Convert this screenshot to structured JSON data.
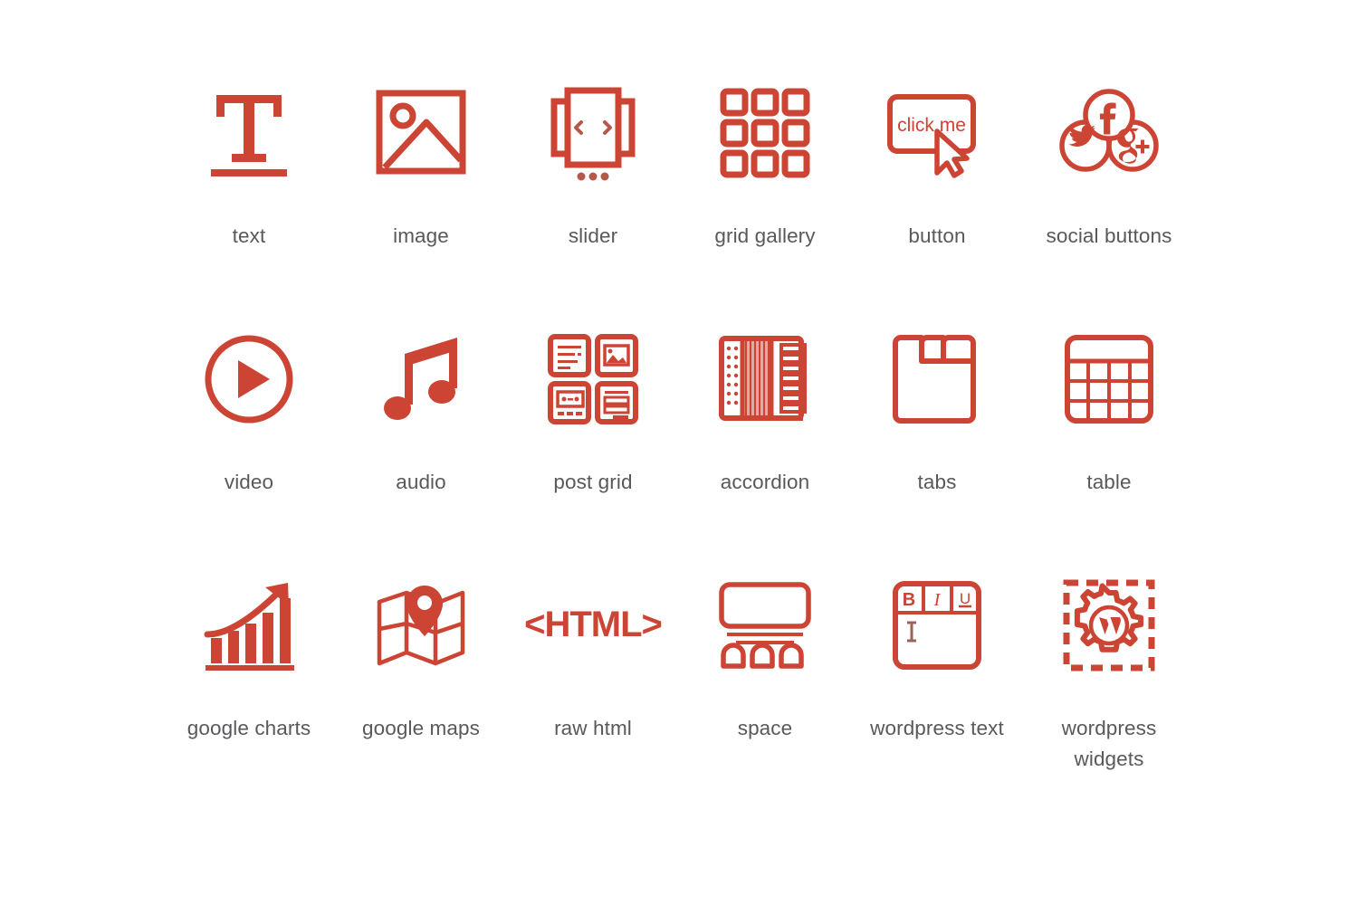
{
  "page": {
    "background_color": "#ffffff",
    "accent_color": "#cc4433",
    "label_color": "#58595b",
    "columns": 6,
    "rows": 3
  },
  "icons": [
    {
      "id": "text",
      "label": "text",
      "icon_name": "serif-t-underline-icon"
    },
    {
      "id": "image",
      "label": "image",
      "icon_name": "picture-frame-icon"
    },
    {
      "id": "slider",
      "label": "slider",
      "icon_name": "carousel-slider-icon"
    },
    {
      "id": "grid_gallery",
      "label": "grid gallery",
      "icon_name": "grid-gallery-icon"
    },
    {
      "id": "button",
      "label": "button",
      "icon_name": "click-me-button-cursor-icon",
      "glyph_text": "click me"
    },
    {
      "id": "social_buttons",
      "label": "social buttons",
      "icon_name": "social-circles-icon",
      "glyph_text": "f"
    },
    {
      "id": "video",
      "label": "video",
      "icon_name": "play-circle-icon"
    },
    {
      "id": "audio",
      "label": "audio",
      "icon_name": "music-note-icon"
    },
    {
      "id": "post_grid",
      "label": "post grid",
      "icon_name": "post-grid-cards-icon"
    },
    {
      "id": "accordion",
      "label": "accordion",
      "icon_name": "accordion-instrument-icon"
    },
    {
      "id": "tabs",
      "label": "tabs",
      "icon_name": "tabs-panel-icon"
    },
    {
      "id": "table",
      "label": "table",
      "icon_name": "table-grid-icon"
    },
    {
      "id": "google_charts",
      "label": "google charts",
      "icon_name": "bar-chart-arrow-icon"
    },
    {
      "id": "google_maps",
      "label": "google maps",
      "icon_name": "folded-map-pin-icon"
    },
    {
      "id": "raw_html",
      "label": "raw html",
      "icon_name": "html-tag-icon",
      "glyph_text": "<HTML>"
    },
    {
      "id": "space",
      "label": "space",
      "icon_name": "spacer-blocks-icon"
    },
    {
      "id": "wordpress_text",
      "label": "wordpress text",
      "icon_name": "wysiwyg-editor-icon",
      "glyph_bold": "B",
      "glyph_italic": "I",
      "glyph_underline": "U"
    },
    {
      "id": "wordpress_widgets",
      "label": "wordpress widgets",
      "icon_name": "wordpress-gear-widget-icon"
    }
  ]
}
